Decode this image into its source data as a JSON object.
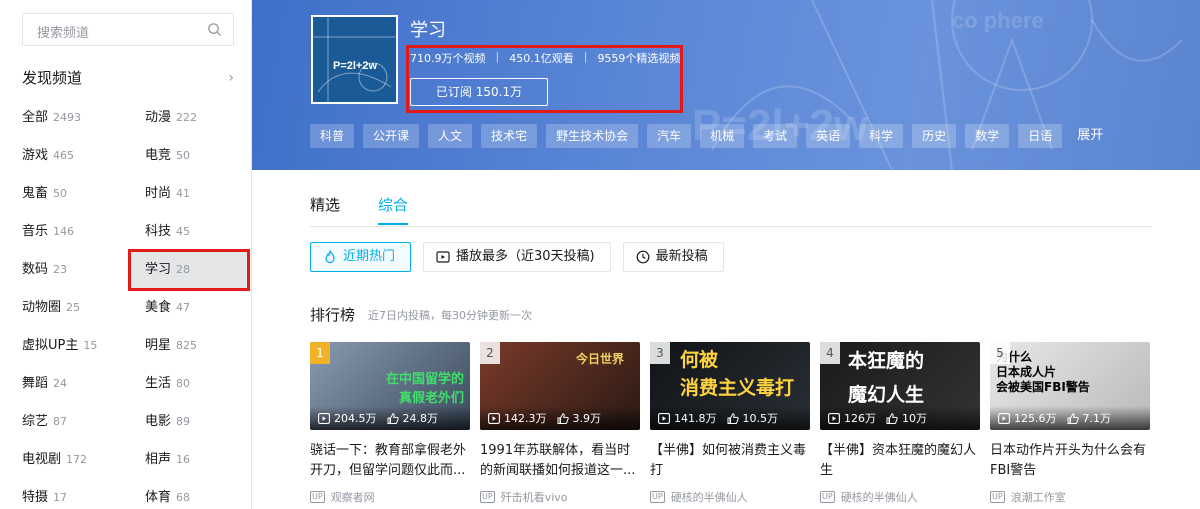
{
  "sidebar": {
    "search_placeholder": "搜索频道",
    "discover_title": "发现频道",
    "categories": [
      {
        "name": "全部",
        "count": "2493"
      },
      {
        "name": "动漫",
        "count": "222"
      },
      {
        "name": "游戏",
        "count": "465"
      },
      {
        "name": "电竞",
        "count": "50"
      },
      {
        "name": "鬼畜",
        "count": "50"
      },
      {
        "name": "时尚",
        "count": "41"
      },
      {
        "name": "音乐",
        "count": "146"
      },
      {
        "name": "科技",
        "count": "45"
      },
      {
        "name": "数码",
        "count": "23"
      },
      {
        "name": "学习",
        "count": "28"
      },
      {
        "name": "动物圈",
        "count": "25"
      },
      {
        "name": "美食",
        "count": "47"
      },
      {
        "name": "虚拟UP主",
        "count": "15"
      },
      {
        "name": "明星",
        "count": "825"
      },
      {
        "name": "舞蹈",
        "count": "24"
      },
      {
        "name": "生活",
        "count": "80"
      },
      {
        "name": "综艺",
        "count": "87"
      },
      {
        "name": "电影",
        "count": "89"
      },
      {
        "name": "电视剧",
        "count": "172"
      },
      {
        "name": "相声",
        "count": "16"
      },
      {
        "name": "特摄",
        "count": "17"
      },
      {
        "name": "体育",
        "count": "68"
      }
    ]
  },
  "channel": {
    "title": "学习",
    "videos": "710.9万个视频",
    "views": "450.1亿观看",
    "featured": "9559个精选视频",
    "subscribe_label": "已订阅 150.1万",
    "tags": [
      "科普",
      "公开课",
      "人文",
      "技术宅",
      "野生技术协会",
      "汽车",
      "机械",
      "考试",
      "英语",
      "科学",
      "历史",
      "数学",
      "日语"
    ],
    "expand_label": "展开",
    "thumb_formula": "P=2l+2w"
  },
  "tabs": [
    "精选",
    "综合"
  ],
  "filters": [
    "近期热门",
    "播放最多（近30天投稿)",
    "最新投稿"
  ],
  "ranking": {
    "title": "排行榜",
    "subtitle": "近7日内投稿，每30分钟更新一次"
  },
  "videos": [
    {
      "rank": "1",
      "plays": "204.5万",
      "likes": "24.8万",
      "title": "骁话一下：教育部拿假老外开刀，但留学问题仅此而...",
      "up": "观察者网",
      "cover_text": "在中国留学的\n真假老外们"
    },
    {
      "rank": "2",
      "plays": "142.3万",
      "likes": "3.9万",
      "title": "1991年苏联解体，看当时的新闻联播如何报道这一...",
      "up": "歼击机看vivo",
      "cover_text": "今日世界"
    },
    {
      "rank": "3",
      "plays": "141.8万",
      "likes": "10.5万",
      "title": "【半佛】如何被消费主义毒打",
      "up": "硬核的半佛仙人",
      "cover_text": "何被\n消费主义毒打"
    },
    {
      "rank": "4",
      "plays": "126万",
      "likes": "10万",
      "title": "【半佛】资本狂魔的魔幻人生",
      "up": "硬核的半佛仙人",
      "cover_text": "本狂魔的\n魔幻人生"
    },
    {
      "rank": "5",
      "plays": "125.6万",
      "likes": "7.1万",
      "title": "日本动作片开头为什么会有FBI警告",
      "up": "浪潮工作室",
      "cover_text": "为什么\n日本成人片\n会被美国FBI警告"
    }
  ],
  "colors": {
    "accent": "#00aeec",
    "banner": "#5a86d6",
    "highlight": "#e11919"
  }
}
